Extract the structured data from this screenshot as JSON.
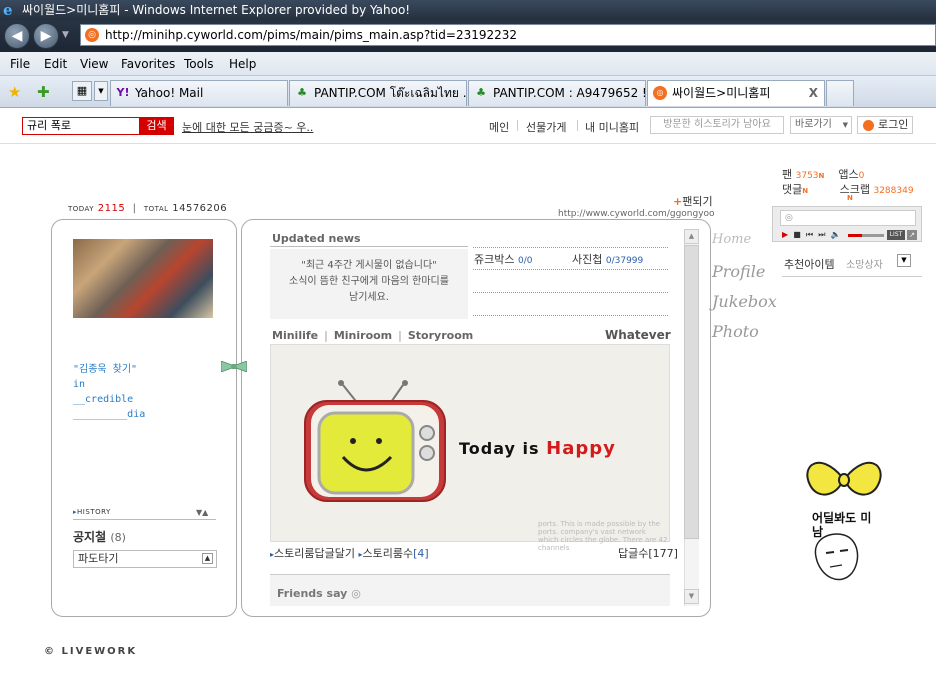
{
  "window": {
    "title": "싸이월드>미니홈피 - Windows Internet Explorer provided by Yahoo!",
    "url": "http://minihp.cyworld.com/pims/main/pims_main.asp?tid=23192232"
  },
  "menu": [
    "File",
    "Edit",
    "View",
    "Favorites",
    "Tools",
    "Help"
  ],
  "tabs": [
    {
      "label": "Yahoo! Mail",
      "icon": "yahoo-icon"
    },
    {
      "label": "PANTIP.COM โต๊ะเฉลิมไทย ...",
      "icon": "cactus-icon"
    },
    {
      "label": "PANTIP.COM : A9479652 !!...",
      "icon": "cactus-icon"
    },
    {
      "label": "싸이월드>미니홈피",
      "icon": "cyworld-icon",
      "active": true
    }
  ],
  "cytop": {
    "search_value": "규리 폭로",
    "search_button": "검색",
    "promo": "눈에 대한 모든 궁금증~ 우..",
    "links": [
      "메인",
      "선물가게",
      "내 미니홈피"
    ],
    "history": "방문한 히스토리가 남아요",
    "goto": "바로가기",
    "login": "로그인"
  },
  "counter": {
    "today_label": "TODAY",
    "today": "2115",
    "total_label": "TOTAL",
    "total": "14576206"
  },
  "profile": {
    "intro": [
      "\"김종욱 찾기\"",
      "in",
      "__credible",
      "_________dia"
    ],
    "history_label": "HISTORY",
    "notice": "공지철",
    "notice_count": "(8)",
    "dropdown": "파도타기"
  },
  "main": {
    "fan_link": "팬되기",
    "site_url": "http://www.cyworld.com/ggongyoo",
    "updated_news": "Updated news",
    "empty_msg_1": "\"최근 4주간 게시물이 없습니다\"",
    "empty_msg_2": "소식이 뜸한 친구에게 마음의 한마디를",
    "empty_msg_3": "남기세요.",
    "jukebox_label": "쥬크박스",
    "jukebox_count": "0/0",
    "photo_label": "사진첩",
    "photo_count": "0/37999",
    "tabs": [
      "Minilife",
      "Miniroom",
      "Storyroom"
    ],
    "whatever": "Whatever",
    "today_is": "Today is",
    "happy": "Happy",
    "fine_print": "ports. This is made possible by the ports. company's vast network which circles the globe. There are 42 channels",
    "story_reply": "스토리룸답글달기",
    "story_count_label": "스토리룸수",
    "story_count": "[4]",
    "reply_label": "답글수",
    "reply_count": "[177]",
    "friends_say": "Friends say"
  },
  "side_menu": [
    "Home",
    "Profile",
    "Jukebox",
    "Photo"
  ],
  "right": {
    "fan_label": "팬",
    "fan_count": "3753",
    "apps_label": "앱스",
    "apps_count": "0",
    "comments_label": "댓글",
    "scrap_label": "스크랩",
    "scrap_count": "3288349",
    "new_badge": "N",
    "list_btn": "LIST",
    "rec_items": "추천아이템",
    "wish_items": "소망상자"
  },
  "deco_text": "어딜봐도 미남",
  "footer": "LIVEWORK",
  "colors": {
    "accent_red": "#d40000",
    "cy_orange": "#f36f21",
    "link_blue": "#2b5fa8"
  }
}
